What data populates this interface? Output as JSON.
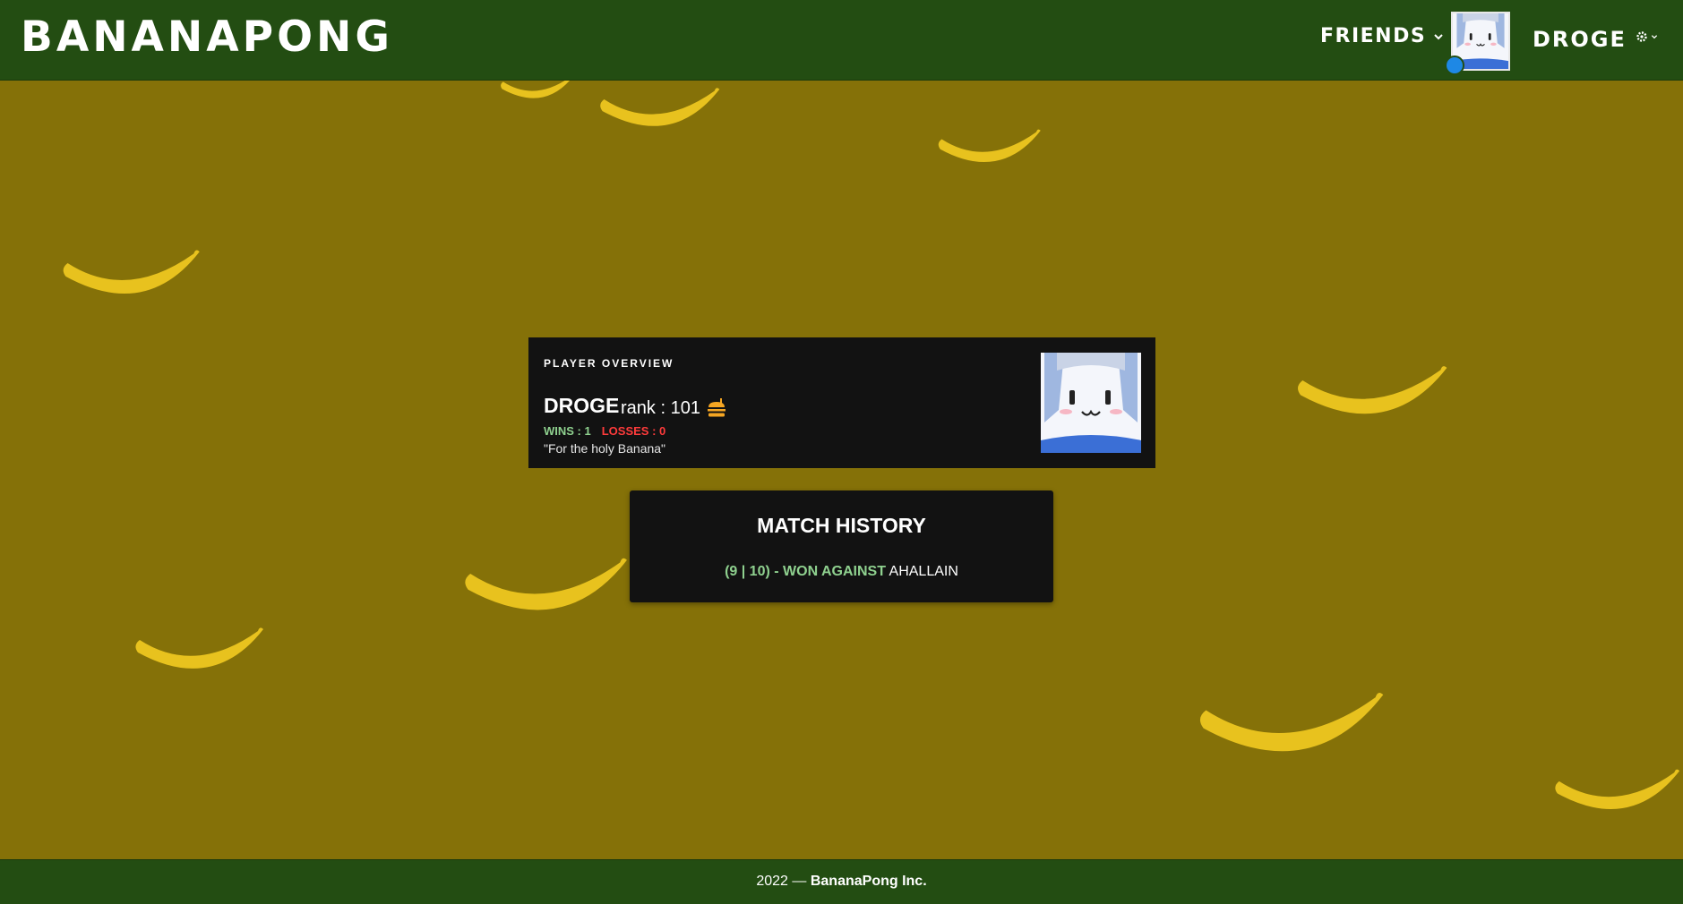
{
  "header": {
    "brand": "BANANAPONG",
    "friends_label": "FRIENDS",
    "username": "DROGE",
    "icons": {
      "friends_chevron": "chevron-down-icon",
      "settings": "gear-icon",
      "settings_chevron": "chevron-down-icon"
    }
  },
  "overview": {
    "title": "PLAYER OVERVIEW",
    "name": "DROGE",
    "rank_text": "rank : 101",
    "rank_icon": "burger-icon",
    "wins_text": "WINS : 1",
    "losses_text": "LOSSES : 0",
    "quote": "\"For the holy Banana\""
  },
  "history": {
    "title": "MATCH HISTORY",
    "matches": [
      {
        "score": "(9 | 10)",
        "separator": " - ",
        "result": "WON AGAINST",
        "opponent": "AHALLAIN"
      }
    ]
  },
  "footer": {
    "year_text": "2022 — ",
    "company": "BananaPong Inc."
  },
  "colors": {
    "header_bg": "#234d12",
    "page_bg": "#857108",
    "card_bg": "#121212",
    "wins": "#8fd18f",
    "losses": "#ff3b3b",
    "online": "#1e88e5"
  }
}
